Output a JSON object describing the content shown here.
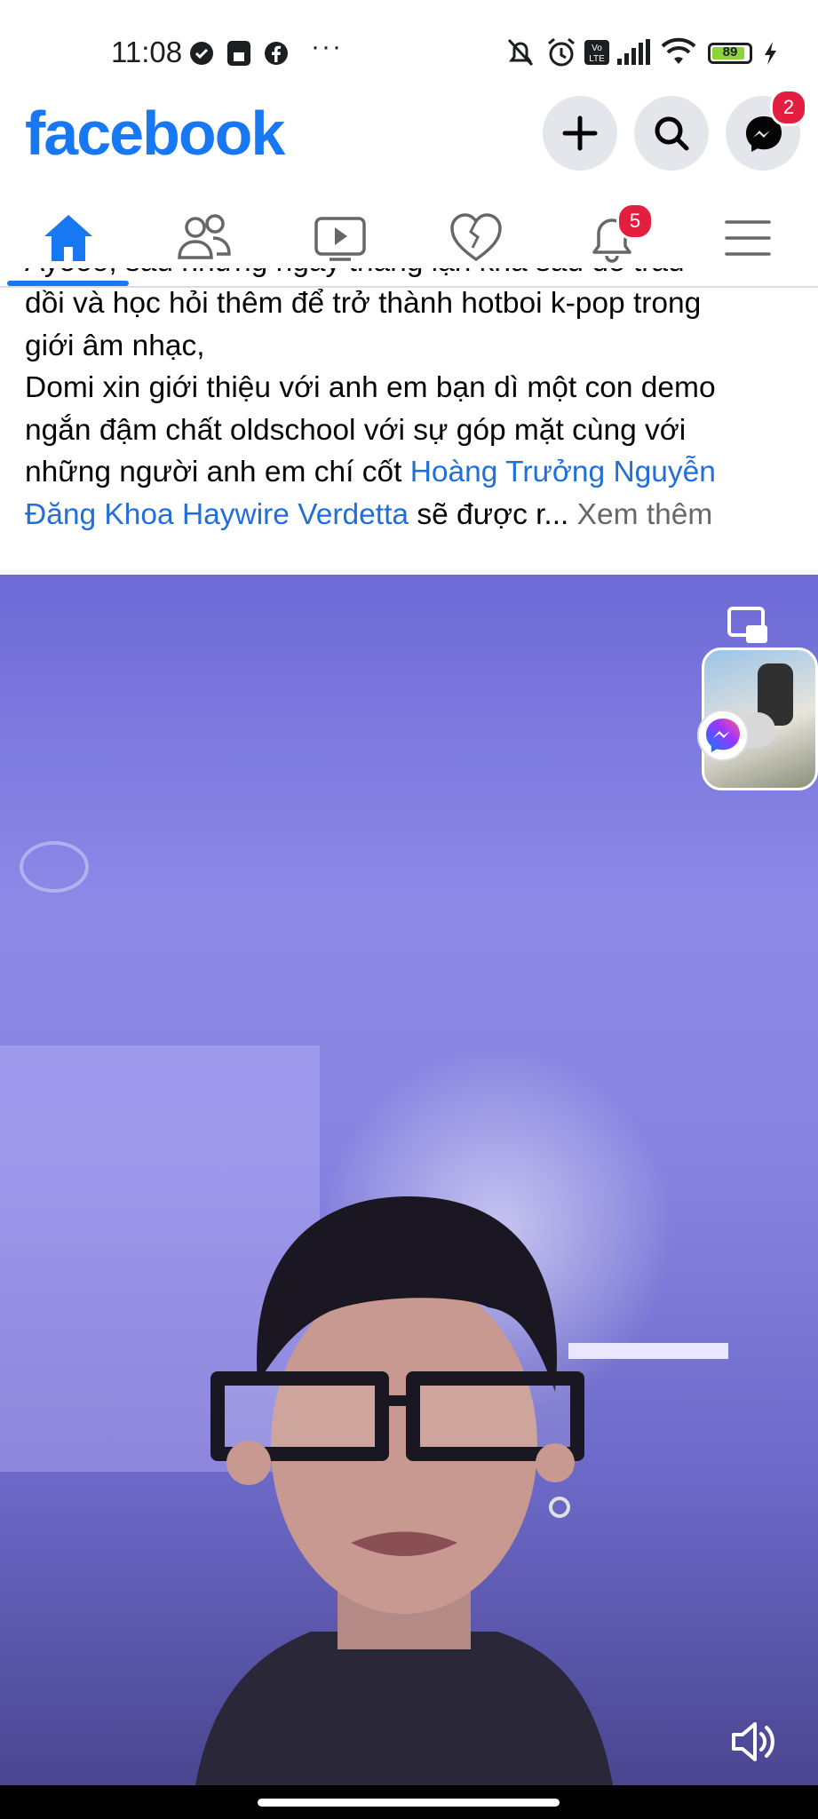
{
  "status_bar": {
    "time": "11:08",
    "battery": "89"
  },
  "header": {
    "logo": "facebook",
    "messenger_badge": "2"
  },
  "nav": {
    "notifications_badge": "5"
  },
  "post": {
    "cutoff_line": "Ayooo, sau những ngày tháng lặn khá sâu để trau",
    "line1": "dồi và học hỏi thêm để trở thành hotboi k-pop trong",
    "line2": "giới âm nhạc,",
    "line3": "Domi xin giới thiệu với anh em bạn dì một con demo",
    "line4": "ngắn đậm chất oldschool với sự góp mặt cùng với",
    "line5_prefix": "những người anh em chí cốt ",
    "link1": "Hoàng Trưởng Nguyễn",
    "link2": "Đăng Khoa Haywire Verdetta",
    "line6_suffix": " sẽ được r...",
    "see_more": "Xem thêm"
  },
  "colors": {
    "brand": "#1877f2",
    "badge": "#e41e3f",
    "link": "#216fdb"
  },
  "icons": {
    "home": "home-icon",
    "friends": "friends-icon",
    "watch": "video-icon",
    "dating": "heart-icon",
    "notifications": "bell-icon",
    "menu": "menu-icon",
    "create": "plus-icon",
    "search": "search-icon",
    "messenger": "messenger-icon",
    "volume": "volume-icon",
    "pip": "picture-in-picture-icon"
  }
}
